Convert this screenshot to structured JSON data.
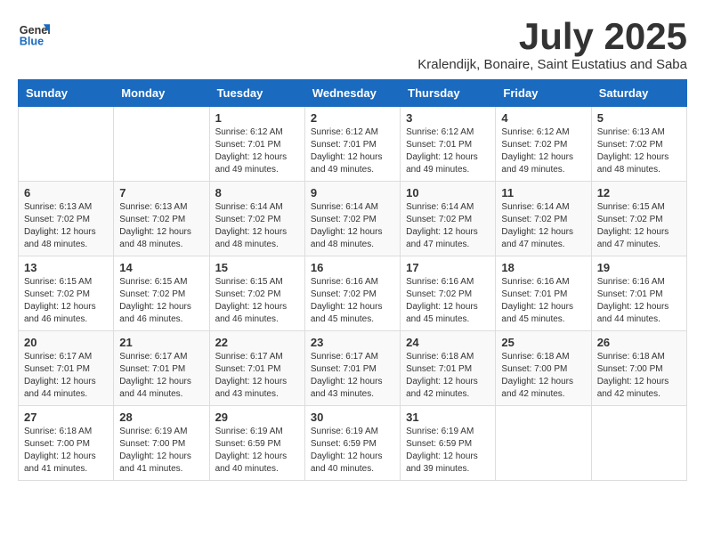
{
  "logo": {
    "line1": "General",
    "line2": "Blue"
  },
  "title": "July 2025",
  "subtitle": "Kralendijk, Bonaire, Saint Eustatius and Saba",
  "weekdays": [
    "Sunday",
    "Monday",
    "Tuesday",
    "Wednesday",
    "Thursday",
    "Friday",
    "Saturday"
  ],
  "weeks": [
    [
      {
        "day": null
      },
      {
        "day": null
      },
      {
        "day": "1",
        "sunrise": "Sunrise: 6:12 AM",
        "sunset": "Sunset: 7:01 PM",
        "daylight": "Daylight: 12 hours and 49 minutes."
      },
      {
        "day": "2",
        "sunrise": "Sunrise: 6:12 AM",
        "sunset": "Sunset: 7:01 PM",
        "daylight": "Daylight: 12 hours and 49 minutes."
      },
      {
        "day": "3",
        "sunrise": "Sunrise: 6:12 AM",
        "sunset": "Sunset: 7:01 PM",
        "daylight": "Daylight: 12 hours and 49 minutes."
      },
      {
        "day": "4",
        "sunrise": "Sunrise: 6:12 AM",
        "sunset": "Sunset: 7:02 PM",
        "daylight": "Daylight: 12 hours and 49 minutes."
      },
      {
        "day": "5",
        "sunrise": "Sunrise: 6:13 AM",
        "sunset": "Sunset: 7:02 PM",
        "daylight": "Daylight: 12 hours and 48 minutes."
      }
    ],
    [
      {
        "day": "6",
        "sunrise": "Sunrise: 6:13 AM",
        "sunset": "Sunset: 7:02 PM",
        "daylight": "Daylight: 12 hours and 48 minutes."
      },
      {
        "day": "7",
        "sunrise": "Sunrise: 6:13 AM",
        "sunset": "Sunset: 7:02 PM",
        "daylight": "Daylight: 12 hours and 48 minutes."
      },
      {
        "day": "8",
        "sunrise": "Sunrise: 6:14 AM",
        "sunset": "Sunset: 7:02 PM",
        "daylight": "Daylight: 12 hours and 48 minutes."
      },
      {
        "day": "9",
        "sunrise": "Sunrise: 6:14 AM",
        "sunset": "Sunset: 7:02 PM",
        "daylight": "Daylight: 12 hours and 48 minutes."
      },
      {
        "day": "10",
        "sunrise": "Sunrise: 6:14 AM",
        "sunset": "Sunset: 7:02 PM",
        "daylight": "Daylight: 12 hours and 47 minutes."
      },
      {
        "day": "11",
        "sunrise": "Sunrise: 6:14 AM",
        "sunset": "Sunset: 7:02 PM",
        "daylight": "Daylight: 12 hours and 47 minutes."
      },
      {
        "day": "12",
        "sunrise": "Sunrise: 6:15 AM",
        "sunset": "Sunset: 7:02 PM",
        "daylight": "Daylight: 12 hours and 47 minutes."
      }
    ],
    [
      {
        "day": "13",
        "sunrise": "Sunrise: 6:15 AM",
        "sunset": "Sunset: 7:02 PM",
        "daylight": "Daylight: 12 hours and 46 minutes."
      },
      {
        "day": "14",
        "sunrise": "Sunrise: 6:15 AM",
        "sunset": "Sunset: 7:02 PM",
        "daylight": "Daylight: 12 hours and 46 minutes."
      },
      {
        "day": "15",
        "sunrise": "Sunrise: 6:15 AM",
        "sunset": "Sunset: 7:02 PM",
        "daylight": "Daylight: 12 hours and 46 minutes."
      },
      {
        "day": "16",
        "sunrise": "Sunrise: 6:16 AM",
        "sunset": "Sunset: 7:02 PM",
        "daylight": "Daylight: 12 hours and 45 minutes."
      },
      {
        "day": "17",
        "sunrise": "Sunrise: 6:16 AM",
        "sunset": "Sunset: 7:02 PM",
        "daylight": "Daylight: 12 hours and 45 minutes."
      },
      {
        "day": "18",
        "sunrise": "Sunrise: 6:16 AM",
        "sunset": "Sunset: 7:01 PM",
        "daylight": "Daylight: 12 hours and 45 minutes."
      },
      {
        "day": "19",
        "sunrise": "Sunrise: 6:16 AM",
        "sunset": "Sunset: 7:01 PM",
        "daylight": "Daylight: 12 hours and 44 minutes."
      }
    ],
    [
      {
        "day": "20",
        "sunrise": "Sunrise: 6:17 AM",
        "sunset": "Sunset: 7:01 PM",
        "daylight": "Daylight: 12 hours and 44 minutes."
      },
      {
        "day": "21",
        "sunrise": "Sunrise: 6:17 AM",
        "sunset": "Sunset: 7:01 PM",
        "daylight": "Daylight: 12 hours and 44 minutes."
      },
      {
        "day": "22",
        "sunrise": "Sunrise: 6:17 AM",
        "sunset": "Sunset: 7:01 PM",
        "daylight": "Daylight: 12 hours and 43 minutes."
      },
      {
        "day": "23",
        "sunrise": "Sunrise: 6:17 AM",
        "sunset": "Sunset: 7:01 PM",
        "daylight": "Daylight: 12 hours and 43 minutes."
      },
      {
        "day": "24",
        "sunrise": "Sunrise: 6:18 AM",
        "sunset": "Sunset: 7:01 PM",
        "daylight": "Daylight: 12 hours and 42 minutes."
      },
      {
        "day": "25",
        "sunrise": "Sunrise: 6:18 AM",
        "sunset": "Sunset: 7:00 PM",
        "daylight": "Daylight: 12 hours and 42 minutes."
      },
      {
        "day": "26",
        "sunrise": "Sunrise: 6:18 AM",
        "sunset": "Sunset: 7:00 PM",
        "daylight": "Daylight: 12 hours and 42 minutes."
      }
    ],
    [
      {
        "day": "27",
        "sunrise": "Sunrise: 6:18 AM",
        "sunset": "Sunset: 7:00 PM",
        "daylight": "Daylight: 12 hours and 41 minutes."
      },
      {
        "day": "28",
        "sunrise": "Sunrise: 6:19 AM",
        "sunset": "Sunset: 7:00 PM",
        "daylight": "Daylight: 12 hours and 41 minutes."
      },
      {
        "day": "29",
        "sunrise": "Sunrise: 6:19 AM",
        "sunset": "Sunset: 6:59 PM",
        "daylight": "Daylight: 12 hours and 40 minutes."
      },
      {
        "day": "30",
        "sunrise": "Sunrise: 6:19 AM",
        "sunset": "Sunset: 6:59 PM",
        "daylight": "Daylight: 12 hours and 40 minutes."
      },
      {
        "day": "31",
        "sunrise": "Sunrise: 6:19 AM",
        "sunset": "Sunset: 6:59 PM",
        "daylight": "Daylight: 12 hours and 39 minutes."
      },
      {
        "day": null
      },
      {
        "day": null
      }
    ]
  ]
}
